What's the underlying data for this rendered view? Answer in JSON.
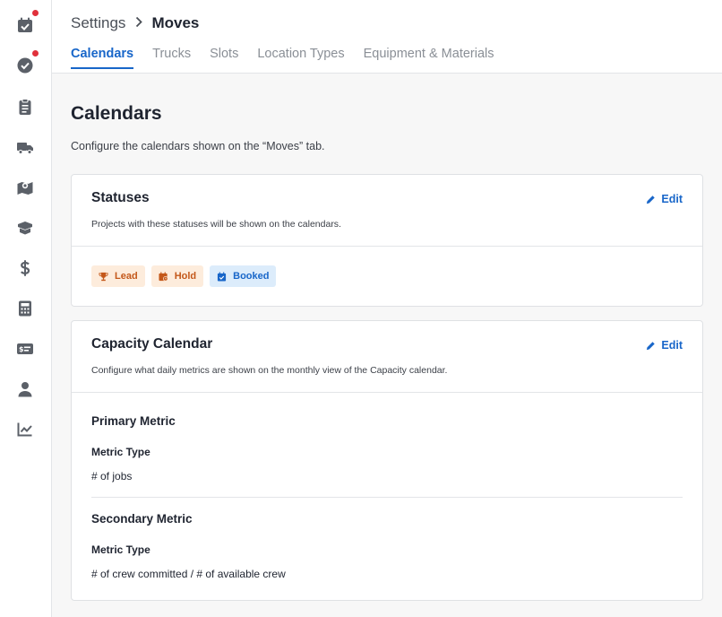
{
  "sidebar": {
    "items": [
      {
        "icon": "calendar-check-icon",
        "badge": true
      },
      {
        "icon": "check-circle-icon",
        "badge": true
      },
      {
        "icon": "clipboard-icon",
        "badge": false
      },
      {
        "icon": "truck-icon",
        "badge": false
      },
      {
        "icon": "map-icon",
        "badge": false
      },
      {
        "icon": "box-icon",
        "badge": false
      },
      {
        "icon": "dollar-icon",
        "badge": false
      },
      {
        "icon": "calculator-icon",
        "badge": false
      },
      {
        "icon": "money-check-icon",
        "badge": false
      },
      {
        "icon": "user-icon",
        "badge": false
      },
      {
        "icon": "chart-line-icon",
        "badge": false
      }
    ]
  },
  "header": {
    "breadcrumb_parent": "Settings",
    "breadcrumb_current": "Moves",
    "tabs": [
      {
        "label": "Calendars",
        "active": true
      },
      {
        "label": "Trucks",
        "active": false
      },
      {
        "label": "Slots",
        "active": false
      },
      {
        "label": "Location Types",
        "active": false
      },
      {
        "label": "Equipment & Materials",
        "active": false
      }
    ]
  },
  "main": {
    "title": "Calendars",
    "description": "Configure the calendars shown on the “Moves” tab."
  },
  "statuses_card": {
    "title": "Statuses",
    "subtitle": "Projects with these statuses will be shown on the calendars.",
    "edit_label": "Edit",
    "badges": [
      {
        "label": "Lead",
        "icon": "trophy-icon",
        "color": "#c4581a"
      },
      {
        "label": "Hold",
        "icon": "calendar-clock-icon",
        "color": "#c4581a"
      },
      {
        "label": "Booked",
        "icon": "calendar-check-icon",
        "color": "#1866c9"
      }
    ]
  },
  "capacity_card": {
    "title": "Capacity Calendar",
    "subtitle": "Configure what daily metrics are shown on the monthly view of the Capacity calendar.",
    "edit_label": "Edit",
    "primary": {
      "title": "Primary Metric",
      "label": "Metric Type",
      "value": "# of jobs"
    },
    "secondary": {
      "title": "Secondary Metric",
      "label": "Metric Type",
      "value": "# of crew committed / # of available crew"
    }
  },
  "colors": {
    "accent": "#1866c9",
    "notification": "#e0313b",
    "warning": "#c4581a"
  }
}
